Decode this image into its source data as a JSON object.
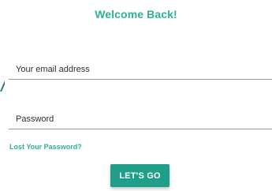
{
  "form": {
    "title": "Welcome Back!",
    "email": {
      "placeholder": "Your email address",
      "value": ""
    },
    "password": {
      "placeholder": "Password",
      "value": ""
    },
    "lost_password_link": "Lost Your Password?",
    "submit_label": "LET'S GO"
  },
  "colors": {
    "accent": "#2eb198",
    "button": "#1f9e8a",
    "underline": "#9a9a9a"
  },
  "icons": {
    "left_accent": "decorative-accent-mark"
  }
}
